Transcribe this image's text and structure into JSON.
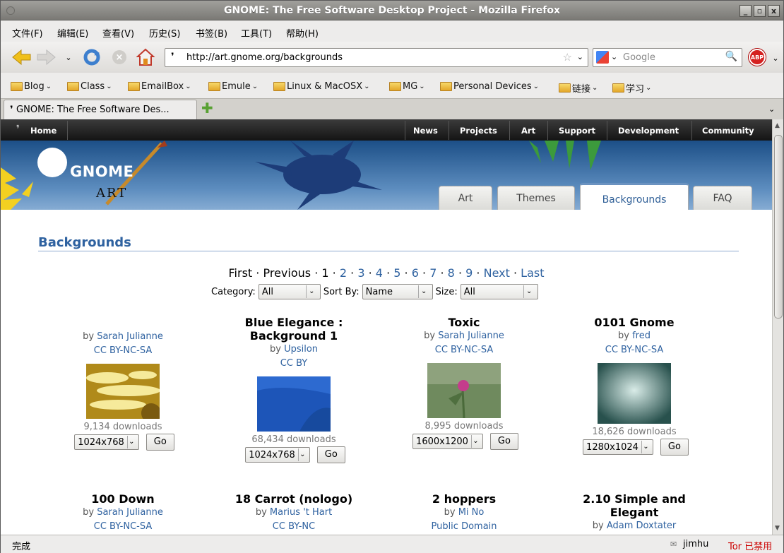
{
  "window": {
    "title": "GNOME: The Free Software Desktop Project - Mozilla Firefox"
  },
  "menu": [
    "文件(F)",
    "编辑(E)",
    "查看(V)",
    "历史(S)",
    "书签(B)",
    "工具(T)",
    "帮助(H)"
  ],
  "nav": {
    "url": "http://art.gnome.org/backgrounds",
    "search_placeholder": "Google"
  },
  "bookmarks": [
    "Blog",
    "Class",
    "EmailBox",
    "Emule",
    "Linux & MacOSX",
    "MG",
    "Personal Devices",
    "链接",
    "学习"
  ],
  "tab": {
    "label": "GNOME: The Free Software Des..."
  },
  "site": {
    "home": "Home",
    "topnav": [
      "News",
      "Projects",
      "Art",
      "Support",
      "Development",
      "Community"
    ],
    "logo_text": "GNOME",
    "logo_sub": "ART",
    "tabs": [
      "Art",
      "Themes",
      "Backgrounds",
      "FAQ"
    ],
    "active_tab": "Backgrounds",
    "section_title": "Backgrounds"
  },
  "pager": {
    "first": "First",
    "previous": "Previous",
    "current": "1",
    "pages": [
      "2",
      "3",
      "4",
      "5",
      "6",
      "7",
      "8",
      "9"
    ],
    "next": "Next",
    "last": "Last",
    "sep": "·"
  },
  "filters": {
    "category_label": "Category:",
    "category": "All",
    "sort_label": "Sort By:",
    "sort": "Name",
    "size_label": "Size:",
    "size": "All"
  },
  "items": [
    {
      "title": "",
      "by": "by",
      "author": "Sarah Julianne",
      "license": "CC BY-NC-SA",
      "downloads": "9,134 downloads",
      "res": "1024x768",
      "go": "Go"
    },
    {
      "title": "Blue Elegance : Background 1",
      "by": "by",
      "author": "Upsilon",
      "license": "CC BY",
      "downloads": "68,434 downloads",
      "res": "1024x768",
      "go": "Go"
    },
    {
      "title": "Toxic",
      "by": "by",
      "author": "Sarah Julianne",
      "license": "CC BY-NC-SA",
      "downloads": "8,995 downloads",
      "res": "1600x1200",
      "go": "Go"
    },
    {
      "title": "0101 Gnome",
      "by": "by",
      "author": "fred",
      "license": "CC BY-NC-SA",
      "downloads": "18,626 downloads",
      "res": "1280x1024",
      "go": "Go"
    },
    {
      "title": "100 Down",
      "by": "by",
      "author": "Sarah Julianne",
      "license": "CC BY-NC-SA"
    },
    {
      "title": "18 Carrot (nologo)",
      "by": "by",
      "author": "Marius 't Hart",
      "license": "CC BY-NC"
    },
    {
      "title": "2 hoppers",
      "by": "by",
      "author": "Mi No",
      "license": "Public Domain"
    },
    {
      "title": "2.10 Simple and Elegant",
      "by": "by",
      "author": "Adam Doxtater",
      "license": ""
    }
  ],
  "status": {
    "left": "完成",
    "user": "jimhu",
    "tor": "Tor 已禁用"
  },
  "colors": {
    "link": "#2f62a0",
    "tor": "#cc0000"
  }
}
